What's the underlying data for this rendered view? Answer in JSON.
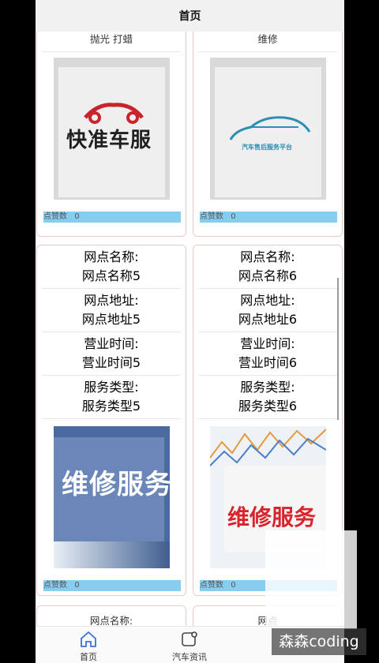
{
  "nav": {
    "title": "首页"
  },
  "likes_label": "点赞数",
  "cards_top": [
    {
      "title": "抛光 打蜡",
      "logo_text": "快准车服",
      "likes": 0
    },
    {
      "title": "维修",
      "logo_text": "汽车售后服务平台",
      "likes": 0
    }
  ],
  "cards_mid": [
    {
      "fields": [
        {
          "label": "网点名称:",
          "value": "网点名称5"
        },
        {
          "label": "网点地址:",
          "value": "网点地址5"
        },
        {
          "label": "营业时间:",
          "value": "营业时间5"
        },
        {
          "label": "服务类型:",
          "value": "服务类型5"
        }
      ],
      "image_text": "维修服务",
      "likes": 0
    },
    {
      "fields": [
        {
          "label": "网点名称:",
          "value": "网点名称6"
        },
        {
          "label": "网点地址:",
          "value": "网点地址6"
        },
        {
          "label": "营业时间:",
          "value": "营业时间6"
        },
        {
          "label": "服务类型:",
          "value": "服务类型6"
        }
      ],
      "image_text": "维修服务",
      "likes": 0
    }
  ],
  "cards_bottom": [
    {
      "label": "网点名称:"
    },
    {
      "label": "网点"
    }
  ],
  "tabbar": [
    {
      "label": "首页",
      "icon": "home-icon",
      "active": true
    },
    {
      "label": "汽车资讯",
      "icon": "news-icon",
      "active": false
    }
  ],
  "watermark": "森森coding",
  "colors": {
    "likes_bar": "#87cdef",
    "card_border": "#efc8c8",
    "active_tab": "#3a6fd8"
  }
}
